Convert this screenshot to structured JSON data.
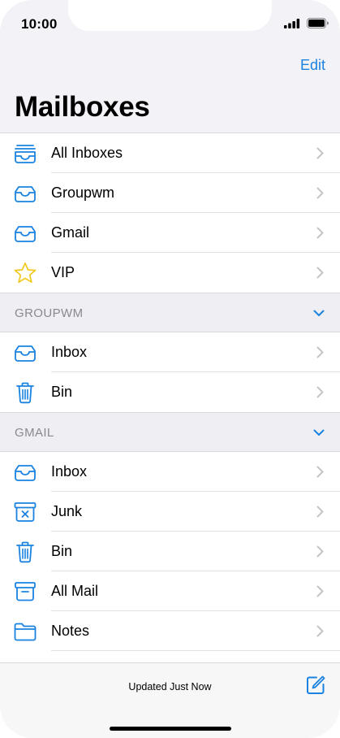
{
  "status_bar": {
    "time": "10:00"
  },
  "header": {
    "edit_label": "Edit",
    "title": "Mailboxes"
  },
  "mailboxes": [
    {
      "label": "All Inboxes",
      "icon": "inbox-stack-icon"
    },
    {
      "label": "Groupwm",
      "icon": "inbox-tray-icon"
    },
    {
      "label": "Gmail",
      "icon": "inbox-tray-icon"
    },
    {
      "label": "VIP",
      "icon": "star-icon"
    }
  ],
  "sections": [
    {
      "title": "GROUPWM",
      "items": [
        {
          "label": "Inbox",
          "icon": "inbox-tray-icon"
        },
        {
          "label": "Bin",
          "icon": "trash-icon"
        }
      ]
    },
    {
      "title": "GMAIL",
      "items": [
        {
          "label": "Inbox",
          "icon": "inbox-tray-icon"
        },
        {
          "label": "Junk",
          "icon": "junk-icon"
        },
        {
          "label": "Bin",
          "icon": "trash-icon"
        },
        {
          "label": "All Mail",
          "icon": "archive-icon"
        },
        {
          "label": "Notes",
          "icon": "folder-icon"
        }
      ]
    }
  ],
  "bottom_bar": {
    "status_text": "Updated Just Now",
    "compose_icon": "compose-icon"
  },
  "colors": {
    "accent": "#1a82e0",
    "star": "#f2c81e",
    "section_bg": "#eeeef3",
    "secondary_text": "#8a8a8e"
  }
}
